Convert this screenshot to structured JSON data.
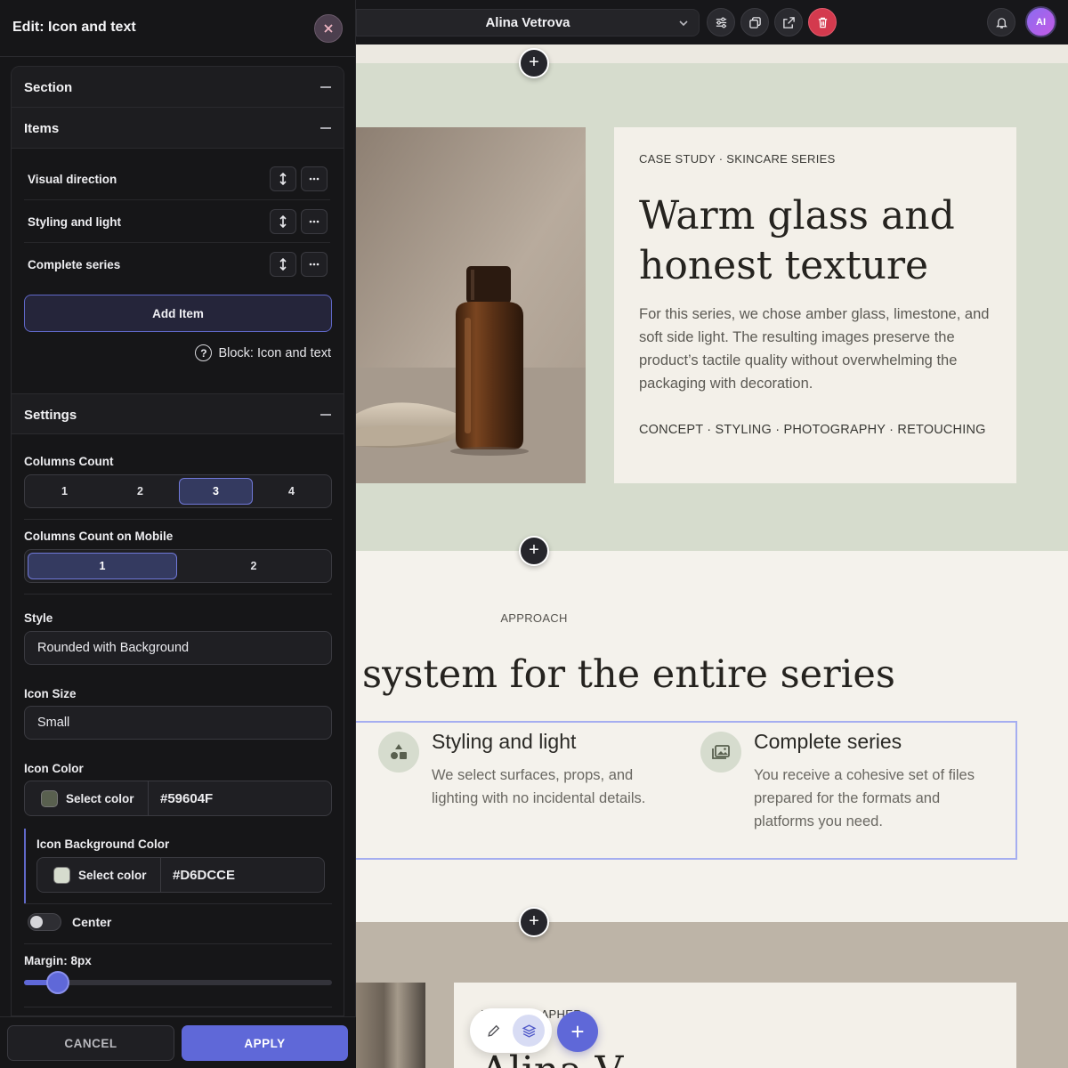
{
  "topbar": {
    "site_name": "Alina Vetrova",
    "avatar_initials": "AI",
    "icons": [
      "chevron-down-icon",
      "sliders-icon",
      "duplicate-icon",
      "external-link-icon",
      "trash-icon",
      "bell-icon"
    ]
  },
  "hero": {
    "eyebrow": "CASE STUDY · SKINCARE SERIES",
    "title": "Warm glass and honest texture",
    "body": "For this series, we chose amber glass, limestone, and soft side light. The resulting images preserve the product’s tactile quality without overwhelming the packaging with decoration.",
    "tags": "CONCEPT · STYLING · PHOTOGRAPHY · RETOUCHING"
  },
  "approach": {
    "eyebrow": "APPROACH",
    "title": "al system for the entire series",
    "features": [
      {
        "title": "Styling and light",
        "body": "We select surfaces, props, and lighting with no incidental details.",
        "icon": "shapes-icon"
      },
      {
        "title": "Complete series",
        "body": "You receive a cohesive set of files prepared for the formats and platforms you need.",
        "icon": "images-icon"
      }
    ]
  },
  "about": {
    "eyebrow": "PHOTOGRAPHER",
    "title": "Alina V"
  },
  "colors": {
    "accent": "#5F68D8",
    "icon_color": "#59604F",
    "icon_bg": "#D6DCCE",
    "hero_bg": "#D6DCCD",
    "panel_bg": "#161618"
  },
  "panel": {
    "title": "Edit: Icon and text",
    "sections": {
      "section": "Section",
      "items": "Items",
      "settings": "Settings"
    },
    "items": [
      "Visual direction",
      "Styling and light",
      "Complete series"
    ],
    "add_item": "Add Item",
    "block_label": "Block: Icon and text",
    "block_help": "?",
    "columns_count": {
      "label": "Columns Count",
      "options": [
        "1",
        "2",
        "3",
        "4"
      ],
      "selected": "3"
    },
    "columns_mobile": {
      "label": "Columns Count on Mobile",
      "options": [
        "1",
        "2"
      ],
      "selected": "1"
    },
    "style": {
      "label": "Style",
      "value": "Rounded with Background"
    },
    "icon_size": {
      "label": "Icon Size",
      "value": "Small"
    },
    "icon_color": {
      "label": "Icon Color",
      "select": "Select color",
      "hex": "#59604F"
    },
    "icon_bg_color": {
      "label": "Icon Background Color",
      "select": "Select color",
      "hex": "#D6DCCE"
    },
    "center": {
      "label": "Center",
      "on": false
    },
    "margin": {
      "label": "Margin: 8px",
      "value": 8,
      "fraction": 0.11
    },
    "cancel": "CANCEL",
    "apply": "APPLY"
  }
}
